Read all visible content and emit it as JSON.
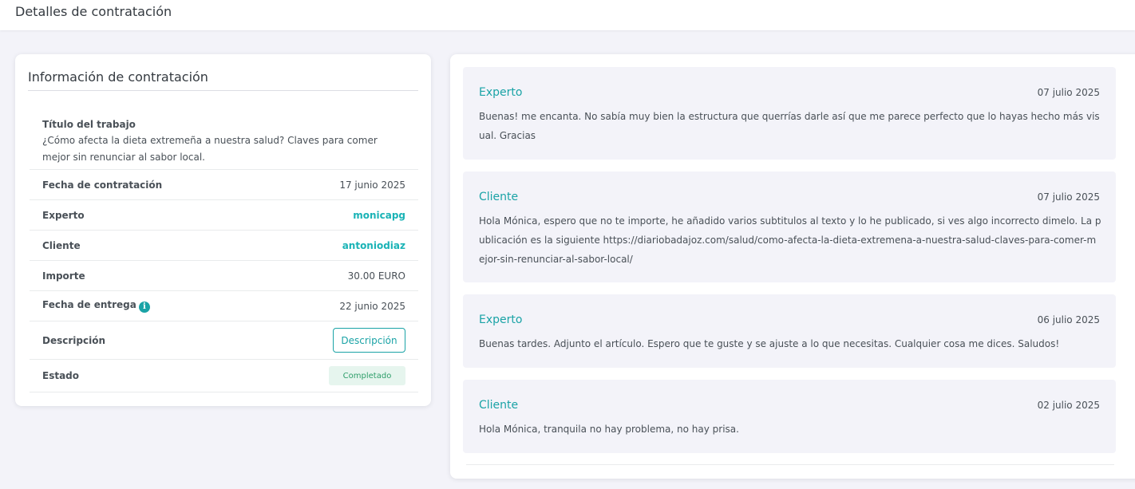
{
  "header": {
    "title": "Detalles de contratación"
  },
  "info": {
    "card_title": "Información de contratación",
    "job_title_label": "Título del trabajo",
    "job_title_value": "¿Cómo afecta la dieta extremeña a nuestra salud? Claves para comer mejor sin renunciar al sabor local.",
    "hire_date_label": "Fecha de contratación",
    "hire_date_value": "17 junio 2025",
    "expert_label": "Experto",
    "expert_value": "monicapg",
    "client_label": "Cliente",
    "client_value": "antoniodiaz",
    "amount_label": "Importe",
    "amount_value": "30.00 EURO",
    "delivery_label": "Fecha de entrega",
    "delivery_value": "22 junio 2025",
    "description_label": "Descripción",
    "description_button": "Descripción",
    "status_label": "Estado",
    "status_value": "Completado",
    "info_icon": "info-circle-icon"
  },
  "messages": [
    {
      "author": "Experto",
      "date": "07 julio 2025",
      "text": "Buenas! me encanta. No sabía muy bien la estructura que querrías darle así que me parece perfecto que lo hayas hecho más visual. Gracias"
    },
    {
      "author": "Cliente",
      "date": "07 julio 2025",
      "text": "Hola Mónica, espero que no te importe, he añadido varios subtitulos al texto y lo he publicado, si ves algo incorrecto dimelo. La publicación es la siguiente https://diariobadajoz.com/salud/como-afecta-la-dieta-extremena-a-nuestra-salud-claves-para-comer-mejor-sin-renunciar-al-sabor-local/"
    },
    {
      "author": "Experto",
      "date": "06 julio 2025",
      "text": "Buenas tardes. Adjunto el artículo. Espero que te guste y se ajuste a lo que necesitas. Cualquier cosa me dices. Saludos!"
    },
    {
      "author": "Cliente",
      "date": "02 julio 2025",
      "text": "Hola Mónica, tranquila no hay problema, no hay prisa."
    }
  ],
  "colors": {
    "accent": "#1aa3a6",
    "background": "#f3f3f9",
    "status_bg": "#e6f5ee",
    "status_text": "#2e9e6a"
  }
}
